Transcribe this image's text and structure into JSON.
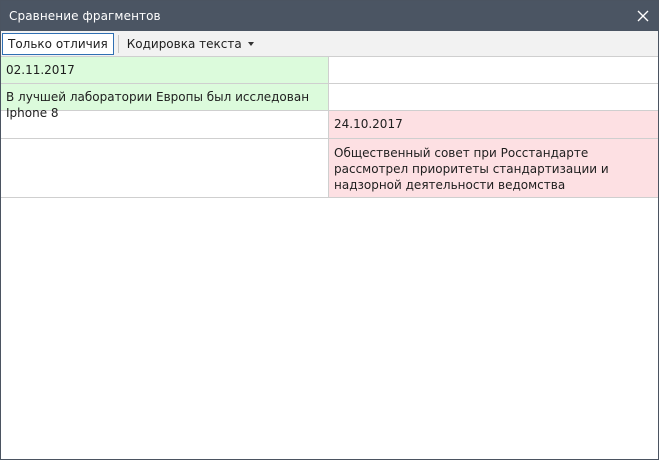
{
  "window": {
    "title": "Сравнение фрагментов"
  },
  "toolbar": {
    "only_diff_label": "Только отличия",
    "encoding_label": "Кодировка текста"
  },
  "rows": [
    {
      "left": "02.11.2017",
      "right": ""
    },
    {
      "left": "В лучшей лаборатории Европы был исследован Iphone 8",
      "right": ""
    },
    {
      "left": "",
      "right": "24.10.2017"
    },
    {
      "left": "",
      "right": "Общественный совет при Росстандарте рассмотрел приоритеты стандартизации и надзорной деятельности ведомства"
    }
  ],
  "colors": {
    "titlebar": "#4b5563",
    "added": "#dcfbdc",
    "removed": "#fde0e3",
    "active_border": "#2f6fb3"
  },
  "icons": {
    "close": "close-icon",
    "dropdown": "chevron-down-icon"
  }
}
